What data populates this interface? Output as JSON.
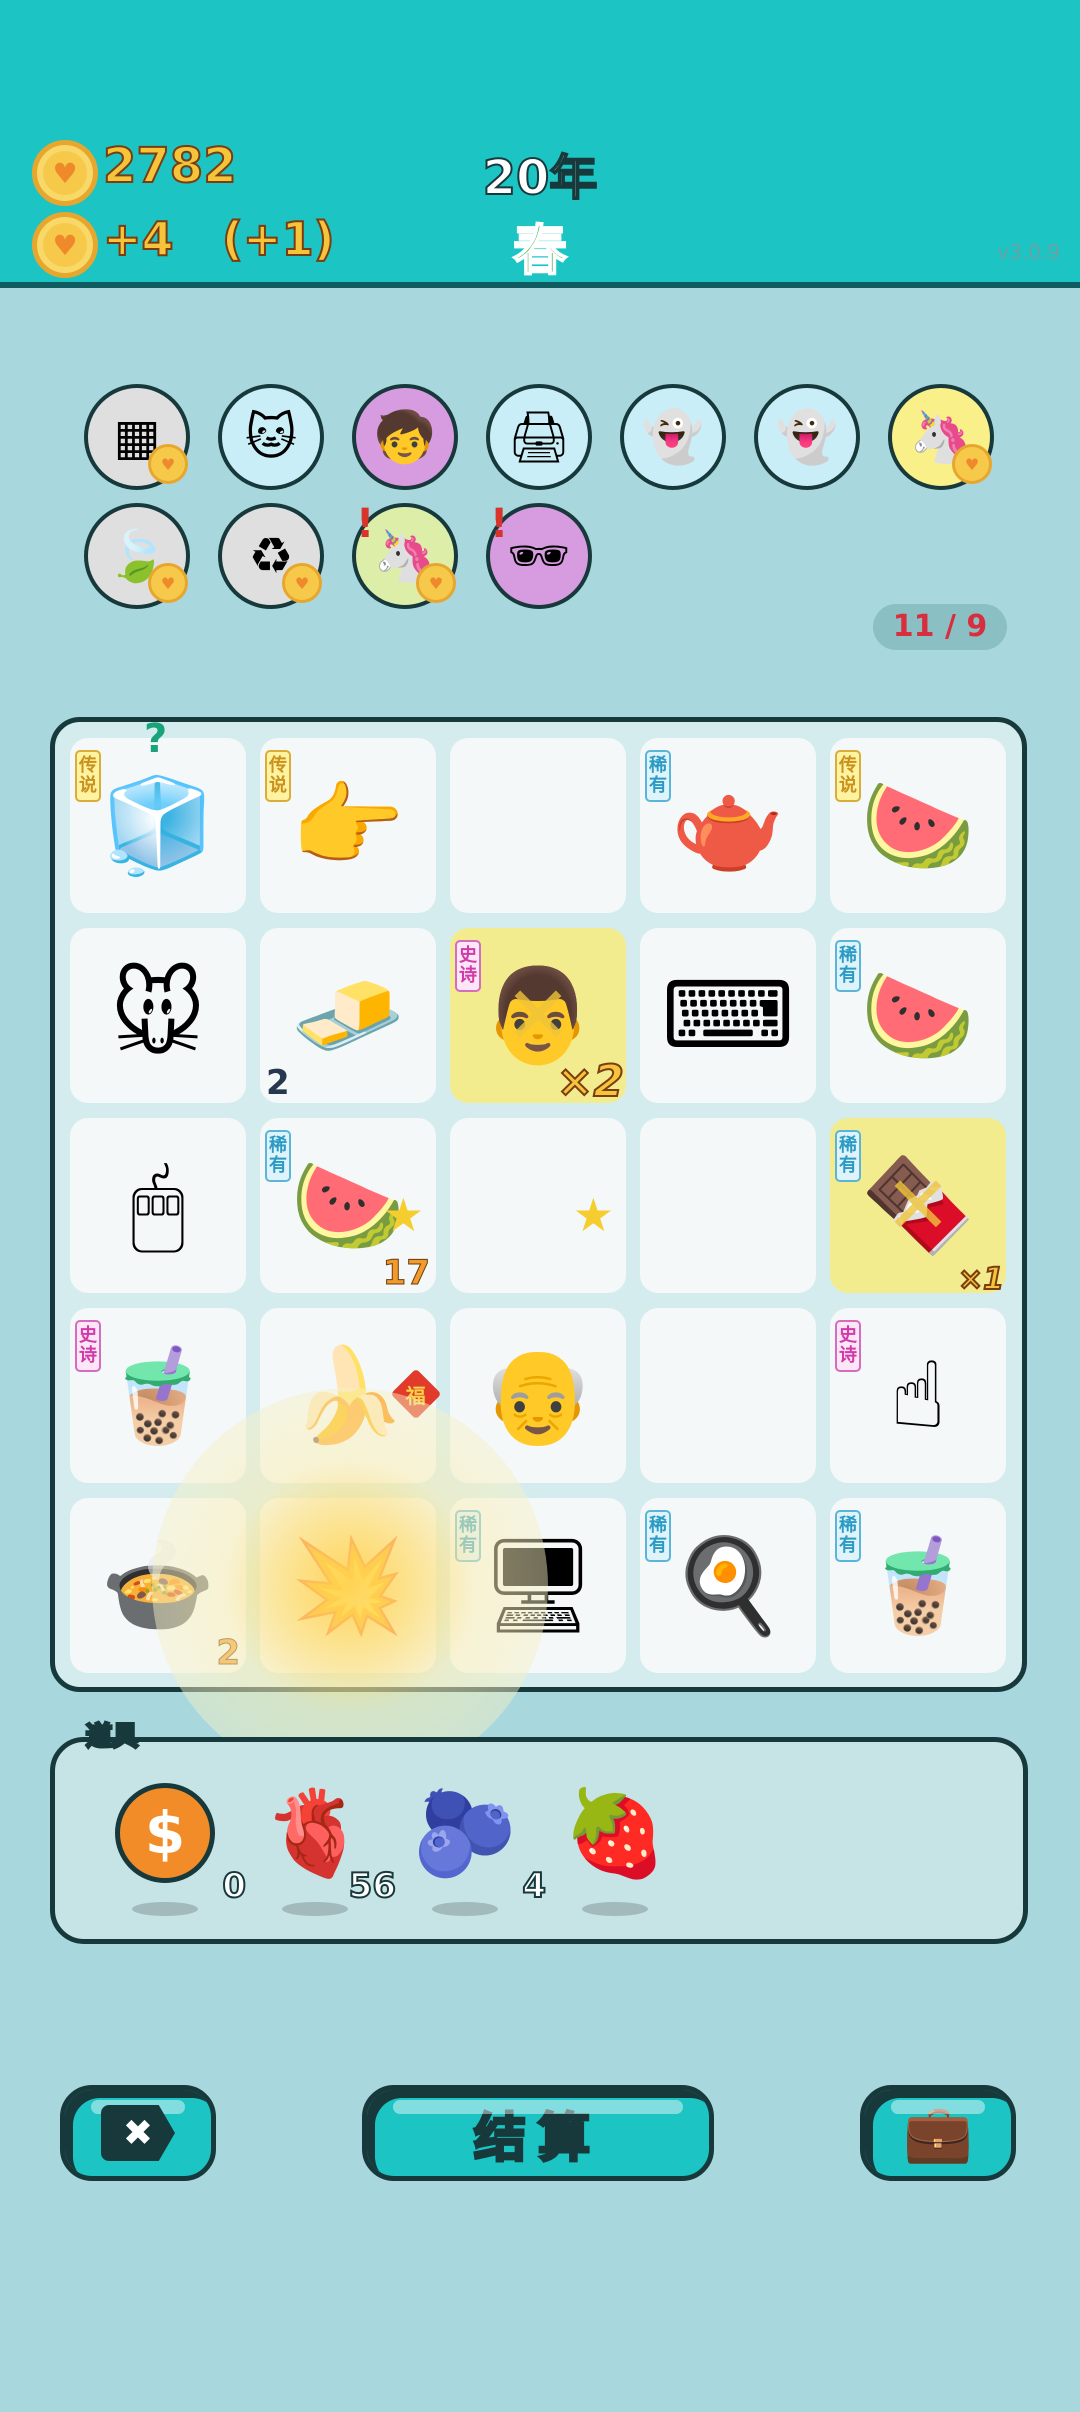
{
  "header": {
    "coins": "2782",
    "income": "+4",
    "bonus": "(+1)",
    "year": "20年",
    "season": "春",
    "version": "v3.0.9"
  },
  "relics": [
    {
      "name": "cubes",
      "icon": "▦",
      "bg": "#dfdfdf",
      "heart": true
    },
    {
      "name": "cool-cat",
      "icon": "🐱",
      "bg": "#c9eef7",
      "heart": false
    },
    {
      "name": "math-kid",
      "icon": "🧒",
      "bg": "#d79be0",
      "heart": false
    },
    {
      "name": "printer",
      "icon": "🖨",
      "bg": "#c9eef7",
      "heart": false
    },
    {
      "name": "ghost-red",
      "icon": "👻",
      "bg": "#c9eef7",
      "heart": false
    },
    {
      "name": "ghost-red-2",
      "icon": "👻",
      "bg": "#c9eef7",
      "heart": false
    },
    {
      "name": "unicorn",
      "icon": "🦄",
      "bg": "#f9f08a",
      "heart": true
    },
    {
      "name": "leaf",
      "icon": "🍃",
      "bg": "#dfdfdf",
      "heart": true
    },
    {
      "name": "recycle",
      "icon": "♻",
      "bg": "#dfdfdf",
      "heart": true
    },
    {
      "name": "unicorn-2",
      "icon": "🦄",
      "bg": "#ddeea9",
      "heart": true,
      "alert": "!"
    },
    {
      "name": "eye-patch",
      "icon": "🕶",
      "bg": "#d79be0",
      "heart": false,
      "alert": "!"
    }
  ],
  "counter": "11 / 9",
  "grid": [
    {
      "icon": "🧊",
      "tag": "传说",
      "tagType": "legend",
      "question": "?"
    },
    {
      "icon": "👉",
      "tag": "传说",
      "tagType": "legend"
    },
    {
      "icon": ""
    },
    {
      "icon": "🫖",
      "tag": "稀有",
      "tagType": "rare"
    },
    {
      "icon": "🍉",
      "tag": "传说",
      "tagType": "legend"
    },
    {
      "icon": "🐭"
    },
    {
      "icon": "🧈",
      "qty": "2"
    },
    {
      "icon": "👨",
      "tag": "史诗",
      "tagType": "epic",
      "mult": "×2",
      "highlight": true,
      "cross": true
    },
    {
      "icon": "⌨"
    },
    {
      "icon": "🍉",
      "tag": "稀有",
      "tagType": "rare"
    },
    {
      "icon": "🖱"
    },
    {
      "icon": "🍉",
      "tag": "稀有",
      "tagType": "rare",
      "star": "★",
      "qtyRight": "17"
    },
    {
      "icon": "",
      "star": "★"
    },
    {
      "icon": ""
    },
    {
      "icon": "🍫",
      "tag": "稀有",
      "tagType": "rare",
      "multSmall": "×1",
      "highlight": true,
      "cross": true
    },
    {
      "icon": "🧋",
      "tag": "史诗",
      "tagType": "epic"
    },
    {
      "icon": "🍌",
      "badge": "福"
    },
    {
      "icon": "👴"
    },
    {
      "icon": ""
    },
    {
      "icon": "☝",
      "tag": "史诗",
      "tagType": "epic"
    },
    {
      "icon": "🍲",
      "qtyRight": "2"
    },
    {
      "icon": "💥"
    },
    {
      "icon": "🖥",
      "tag": "稀有",
      "tagType": "rare"
    },
    {
      "icon": "🍳",
      "tag": "稀有",
      "tagType": "rare"
    },
    {
      "icon": "🧋",
      "tag": "稀有",
      "tagType": "rare"
    }
  ],
  "tools": {
    "title": "道具",
    "items": [
      {
        "name": "coin",
        "icon": "$",
        "count": "0"
      },
      {
        "name": "liver",
        "icon": "🫀",
        "count": "56"
      },
      {
        "name": "blueberry",
        "icon": "🫐",
        "count": "4"
      },
      {
        "name": "strawberry",
        "icon": "🍓",
        "count": ""
      }
    ]
  },
  "buttons": {
    "left_icon": "✖",
    "settle": "结算",
    "right_icon": "💼"
  }
}
